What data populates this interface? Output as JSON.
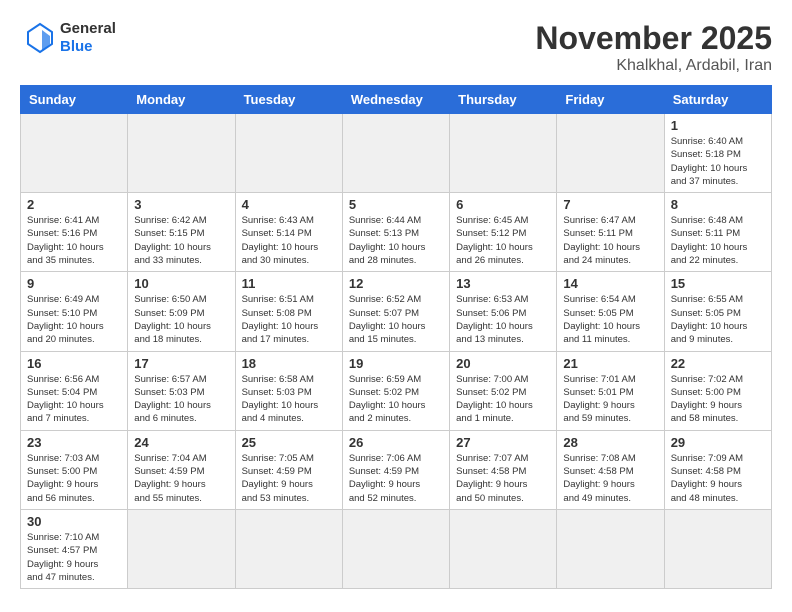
{
  "logo": {
    "text_general": "General",
    "text_blue": "Blue"
  },
  "header": {
    "month_year": "November 2025",
    "location": "Khalkhal, Ardabil, Iran"
  },
  "weekdays": [
    "Sunday",
    "Monday",
    "Tuesday",
    "Wednesday",
    "Thursday",
    "Friday",
    "Saturday"
  ],
  "days": [
    {
      "date": "",
      "info": ""
    },
    {
      "date": "",
      "info": ""
    },
    {
      "date": "",
      "info": ""
    },
    {
      "date": "",
      "info": ""
    },
    {
      "date": "",
      "info": ""
    },
    {
      "date": "",
      "info": ""
    },
    {
      "date": "1",
      "info": "Sunrise: 6:40 AM\nSunset: 5:18 PM\nDaylight: 10 hours\nand 37 minutes."
    },
    {
      "date": "2",
      "info": "Sunrise: 6:41 AM\nSunset: 5:16 PM\nDaylight: 10 hours\nand 35 minutes."
    },
    {
      "date": "3",
      "info": "Sunrise: 6:42 AM\nSunset: 5:15 PM\nDaylight: 10 hours\nand 33 minutes."
    },
    {
      "date": "4",
      "info": "Sunrise: 6:43 AM\nSunset: 5:14 PM\nDaylight: 10 hours\nand 30 minutes."
    },
    {
      "date": "5",
      "info": "Sunrise: 6:44 AM\nSunset: 5:13 PM\nDaylight: 10 hours\nand 28 minutes."
    },
    {
      "date": "6",
      "info": "Sunrise: 6:45 AM\nSunset: 5:12 PM\nDaylight: 10 hours\nand 26 minutes."
    },
    {
      "date": "7",
      "info": "Sunrise: 6:47 AM\nSunset: 5:11 PM\nDaylight: 10 hours\nand 24 minutes."
    },
    {
      "date": "8",
      "info": "Sunrise: 6:48 AM\nSunset: 5:11 PM\nDaylight: 10 hours\nand 22 minutes."
    },
    {
      "date": "9",
      "info": "Sunrise: 6:49 AM\nSunset: 5:10 PM\nDaylight: 10 hours\nand 20 minutes."
    },
    {
      "date": "10",
      "info": "Sunrise: 6:50 AM\nSunset: 5:09 PM\nDaylight: 10 hours\nand 18 minutes."
    },
    {
      "date": "11",
      "info": "Sunrise: 6:51 AM\nSunset: 5:08 PM\nDaylight: 10 hours\nand 17 minutes."
    },
    {
      "date": "12",
      "info": "Sunrise: 6:52 AM\nSunset: 5:07 PM\nDaylight: 10 hours\nand 15 minutes."
    },
    {
      "date": "13",
      "info": "Sunrise: 6:53 AM\nSunset: 5:06 PM\nDaylight: 10 hours\nand 13 minutes."
    },
    {
      "date": "14",
      "info": "Sunrise: 6:54 AM\nSunset: 5:05 PM\nDaylight: 10 hours\nand 11 minutes."
    },
    {
      "date": "15",
      "info": "Sunrise: 6:55 AM\nSunset: 5:05 PM\nDaylight: 10 hours\nand 9 minutes."
    },
    {
      "date": "16",
      "info": "Sunrise: 6:56 AM\nSunset: 5:04 PM\nDaylight: 10 hours\nand 7 minutes."
    },
    {
      "date": "17",
      "info": "Sunrise: 6:57 AM\nSunset: 5:03 PM\nDaylight: 10 hours\nand 6 minutes."
    },
    {
      "date": "18",
      "info": "Sunrise: 6:58 AM\nSunset: 5:03 PM\nDaylight: 10 hours\nand 4 minutes."
    },
    {
      "date": "19",
      "info": "Sunrise: 6:59 AM\nSunset: 5:02 PM\nDaylight: 10 hours\nand 2 minutes."
    },
    {
      "date": "20",
      "info": "Sunrise: 7:00 AM\nSunset: 5:02 PM\nDaylight: 10 hours\nand 1 minute."
    },
    {
      "date": "21",
      "info": "Sunrise: 7:01 AM\nSunset: 5:01 PM\nDaylight: 9 hours\nand 59 minutes."
    },
    {
      "date": "22",
      "info": "Sunrise: 7:02 AM\nSunset: 5:00 PM\nDaylight: 9 hours\nand 58 minutes."
    },
    {
      "date": "23",
      "info": "Sunrise: 7:03 AM\nSunset: 5:00 PM\nDaylight: 9 hours\nand 56 minutes."
    },
    {
      "date": "24",
      "info": "Sunrise: 7:04 AM\nSunset: 4:59 PM\nDaylight: 9 hours\nand 55 minutes."
    },
    {
      "date": "25",
      "info": "Sunrise: 7:05 AM\nSunset: 4:59 PM\nDaylight: 9 hours\nand 53 minutes."
    },
    {
      "date": "26",
      "info": "Sunrise: 7:06 AM\nSunset: 4:59 PM\nDaylight: 9 hours\nand 52 minutes."
    },
    {
      "date": "27",
      "info": "Sunrise: 7:07 AM\nSunset: 4:58 PM\nDaylight: 9 hours\nand 50 minutes."
    },
    {
      "date": "28",
      "info": "Sunrise: 7:08 AM\nSunset: 4:58 PM\nDaylight: 9 hours\nand 49 minutes."
    },
    {
      "date": "29",
      "info": "Sunrise: 7:09 AM\nSunset: 4:58 PM\nDaylight: 9 hours\nand 48 minutes."
    },
    {
      "date": "30",
      "info": "Sunrise: 7:10 AM\nSunset: 4:57 PM\nDaylight: 9 hours\nand 47 minutes."
    },
    {
      "date": "",
      "info": ""
    },
    {
      "date": "",
      "info": ""
    },
    {
      "date": "",
      "info": ""
    },
    {
      "date": "",
      "info": ""
    },
    {
      "date": "",
      "info": ""
    },
    {
      "date": "",
      "info": ""
    }
  ]
}
